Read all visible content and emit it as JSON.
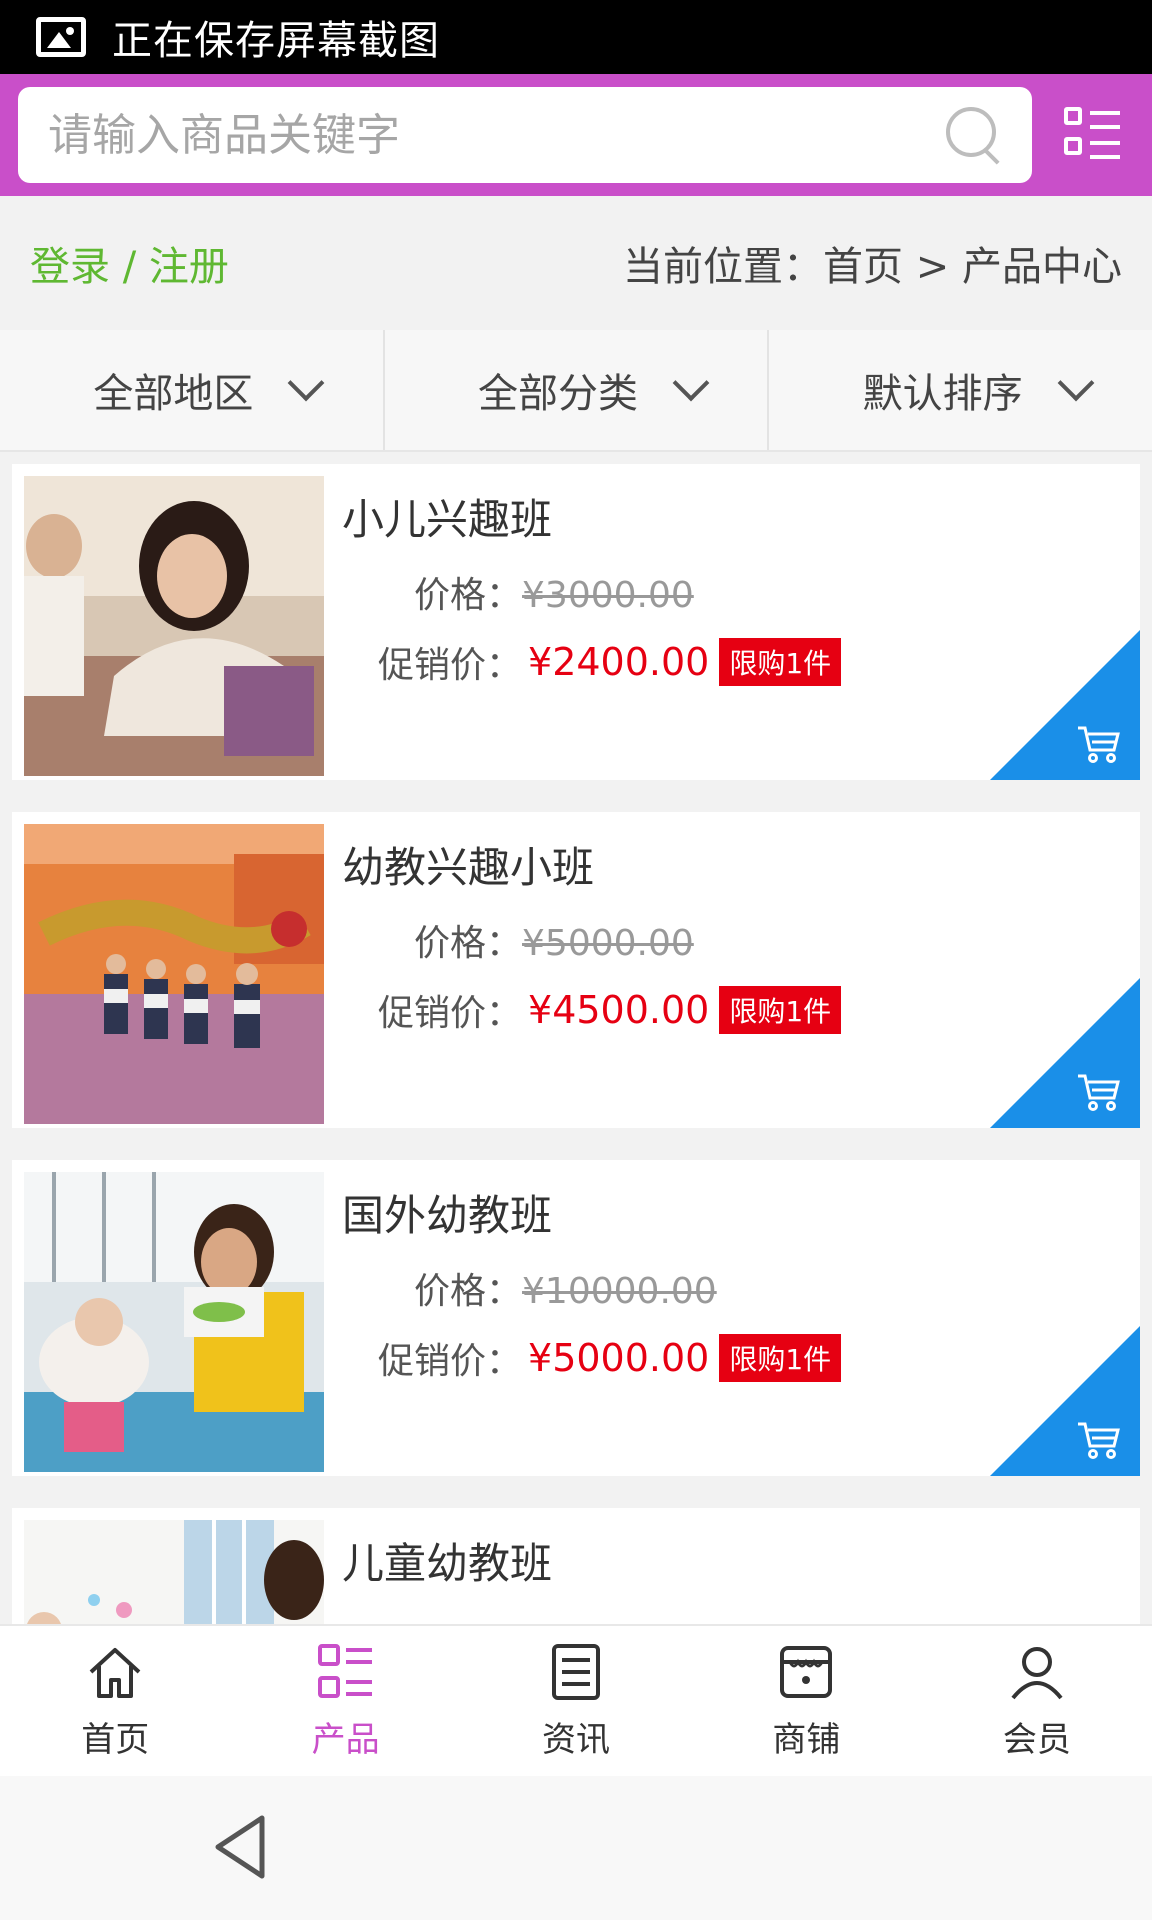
{
  "status_bar": {
    "text": "正在保存屏幕截图",
    "icon": "image-icon"
  },
  "search": {
    "placeholder": "请输入商品关键字",
    "icon": "search-icon",
    "menu_icon": "grid-menu-icon"
  },
  "info_bar": {
    "login_label": "登录 / 注册",
    "breadcrumb": "当前位置：首页 > 产品中心"
  },
  "filters": [
    {
      "label": "全部地区"
    },
    {
      "label": "全部分类"
    },
    {
      "label": "默认排序"
    }
  ],
  "products": [
    {
      "title": "小儿兴趣班",
      "price_label": "价格：",
      "price": "¥3000.00",
      "promo_label": "促销价：",
      "promo_price": "¥2400.00",
      "limit": "限购1件"
    },
    {
      "title": "幼教兴趣小班",
      "price_label": "价格：",
      "price": "¥5000.00",
      "promo_label": "促销价：",
      "promo_price": "¥4500.00",
      "limit": "限购1件"
    },
    {
      "title": "国外幼教班",
      "price_label": "价格：",
      "price": "¥10000.00",
      "promo_label": "促销价：",
      "promo_price": "¥5000.00",
      "limit": "限购1件"
    },
    {
      "title": "儿童幼教班"
    }
  ],
  "bottom_nav": [
    {
      "label": "首页",
      "icon": "home-icon"
    },
    {
      "label": "产品",
      "icon": "product-grid-icon",
      "active": true
    },
    {
      "label": "资讯",
      "icon": "news-icon"
    },
    {
      "label": "商铺",
      "icon": "store-icon"
    },
    {
      "label": "会员",
      "icon": "user-icon"
    }
  ],
  "colors": {
    "header": "#c94fc9",
    "accent_green": "#5fb832",
    "promo_red": "#e60012",
    "cart_blue": "#1a8fe8"
  }
}
